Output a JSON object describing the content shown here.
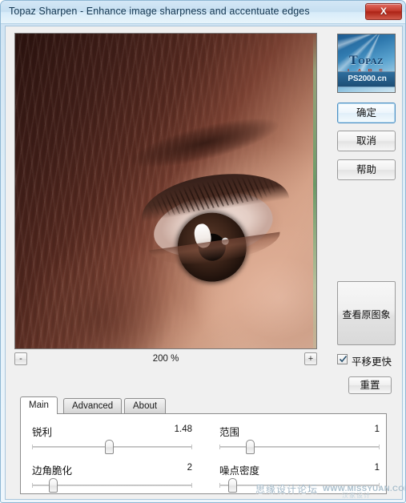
{
  "window": {
    "title": "Topaz Sharpen - Enhance image sharpness and accentuate edges",
    "close_label": "X"
  },
  "preview": {
    "zoom_level": "200 %",
    "zoom_out_label": "-",
    "zoom_in_label": "+"
  },
  "logo": {
    "brand": "Topaz",
    "sub": "L A B S",
    "banner": "PS2000.cn"
  },
  "actions": {
    "ok_label": "确定",
    "cancel_label": "取消",
    "help_label": "帮助",
    "view_original_label": "查看原图象",
    "pan_faster_label": "平移更快",
    "reset_label": "重置"
  },
  "tabs": [
    {
      "label": "Main"
    },
    {
      "label": "Advanced"
    },
    {
      "label": "About"
    }
  ],
  "sliders": [
    {
      "label": "锐利",
      "value": "1.48",
      "percent": 48
    },
    {
      "label": "范围",
      "value": "1",
      "percent": 19
    },
    {
      "label": "边角脆化",
      "value": "2",
      "percent": 13
    },
    {
      "label": "噪点密度",
      "value": "1",
      "percent": 8
    }
  ],
  "watermark": {
    "forum": "思缘设计论坛",
    "url": "WWW.MISSYUAN.COM",
    "ghost": "汉家设计"
  },
  "colors": {
    "accent": "#4d90c4",
    "close_red": "#c33a2c",
    "titlebar": "#c6dff1",
    "panel": "#f0f0f0"
  }
}
